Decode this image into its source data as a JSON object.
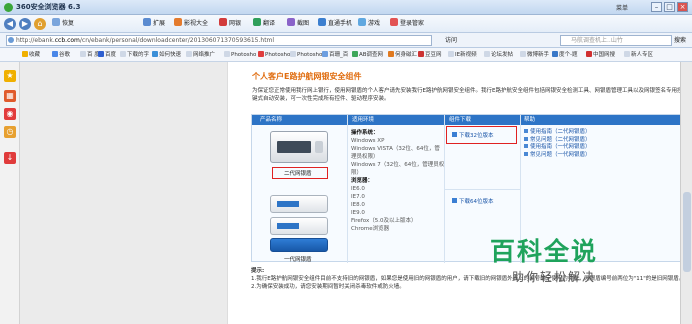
{
  "window": {
    "title": "360安全浏览器 6.3",
    "menu_label": "菜单",
    "min": "–",
    "max": "□",
    "close": "×"
  },
  "toolbar": {
    "back": "◀",
    "forward": "▶",
    "home": "⌂",
    "items": [
      "恢复",
      "扩展",
      "影视大全",
      "网银",
      "翻译",
      "截图",
      "直通手机",
      "游戏",
      "登录管家"
    ]
  },
  "address": {
    "url_prefix": "http://ebank.",
    "url_domain": "ccb.com",
    "url_suffix": "/cn/ebank/personal/downloadcenter/20130607137059361​5.html",
    "zoom_label": "访问",
    "search_placeholder": "马航调查机上..山竹",
    "search_button": "搜索"
  },
  "favorites": [
    "收藏",
    "谷歌",
    "百 度",
    "百度",
    "下载的字",
    "如何快速",
    "网络推广",
    "Photosho",
    "Photosho",
    "Photosho",
    "百珊_百",
    "AB调查网",
    "何身磁汇",
    "豆豆网",
    "IE新视频",
    "论坛发帖",
    "微博新手",
    "度个-题",
    "中国网搜",
    "新人专区"
  ],
  "sidebar": {
    "icons": [
      "star-icon",
      "calendar-icon",
      "weibo-icon",
      "clock-icon",
      "download-icon"
    ]
  },
  "page": {
    "heading": "个人客户E路护航网银安全组件",
    "intro": "为保证您正常使用我行网上银行，使用网银盾的个人客户请先安装我行E路护航网银安全组件。我行E路护航安全组件包括网银安全检测工具、网银盾管理工具以及网银签名专用控件。一键式自动安装，可一次性完成所有控件、驱动程序安装。",
    "table": {
      "headers": [
        "产品名称",
        "适用环境",
        "组件下载",
        "帮助"
      ],
      "os_label": "操作系统：",
      "os_list": [
        "Windows XP",
        "Windows VISTA（32位、64位，管理员权限）",
        "Windows 7（32位、64位，管理员权限）"
      ],
      "browser_label": "浏览器：",
      "browser_list": [
        "IE6.0",
        "IE7.0",
        "IE8.0",
        "IE9.0",
        "Firefox（5.0及以上版本）",
        "Chrome浏览器"
      ],
      "download_32": "下载32位版本",
      "download_64": "下载64位版本",
      "help_items": [
        "使用指南（二代网银盾）",
        "常见问题（二代网银盾）",
        "使用指南（一代网银盾）",
        "常见问题（一代网银盾）"
      ],
      "gen2_label": "二代网银盾",
      "gen1_label": "一代网银盾"
    },
    "tips_title": "提示:",
    "tips": [
      "1.我行E路护航网银安全组件目前不支持旧的网银盾，如果您是使用旧的网银盾的用户，请下载旧的网银盾外壳上的编号确定使用的类型，网银盾编号前两位为\"11\"的是旧网银盾。",
      "2.为确保安装成功，请您安装期间暂时关闭杀毒软件或防火墙。"
    ]
  },
  "watermark": {
    "line1": "百科全说",
    "line2": "助你轻松解决"
  },
  "colors": {
    "brand_blue": "#2d74c6",
    "heading_orange": "#e06d10",
    "highlight_red": "#e02222",
    "watermark_green": "#1fa35c"
  }
}
